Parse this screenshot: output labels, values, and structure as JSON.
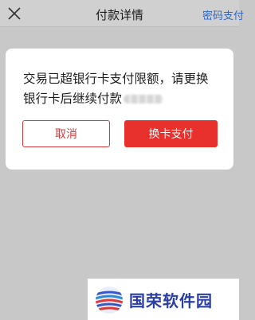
{
  "header": {
    "title": "付款详情",
    "right_action": "密码支付"
  },
  "dialog": {
    "message": "交易已超银行卡支付限额，请更换银行卡后继续付款",
    "cancel_label": "取消",
    "change_card_label": "换卡支付"
  },
  "watermark": {
    "text": "国荣软件园"
  }
}
